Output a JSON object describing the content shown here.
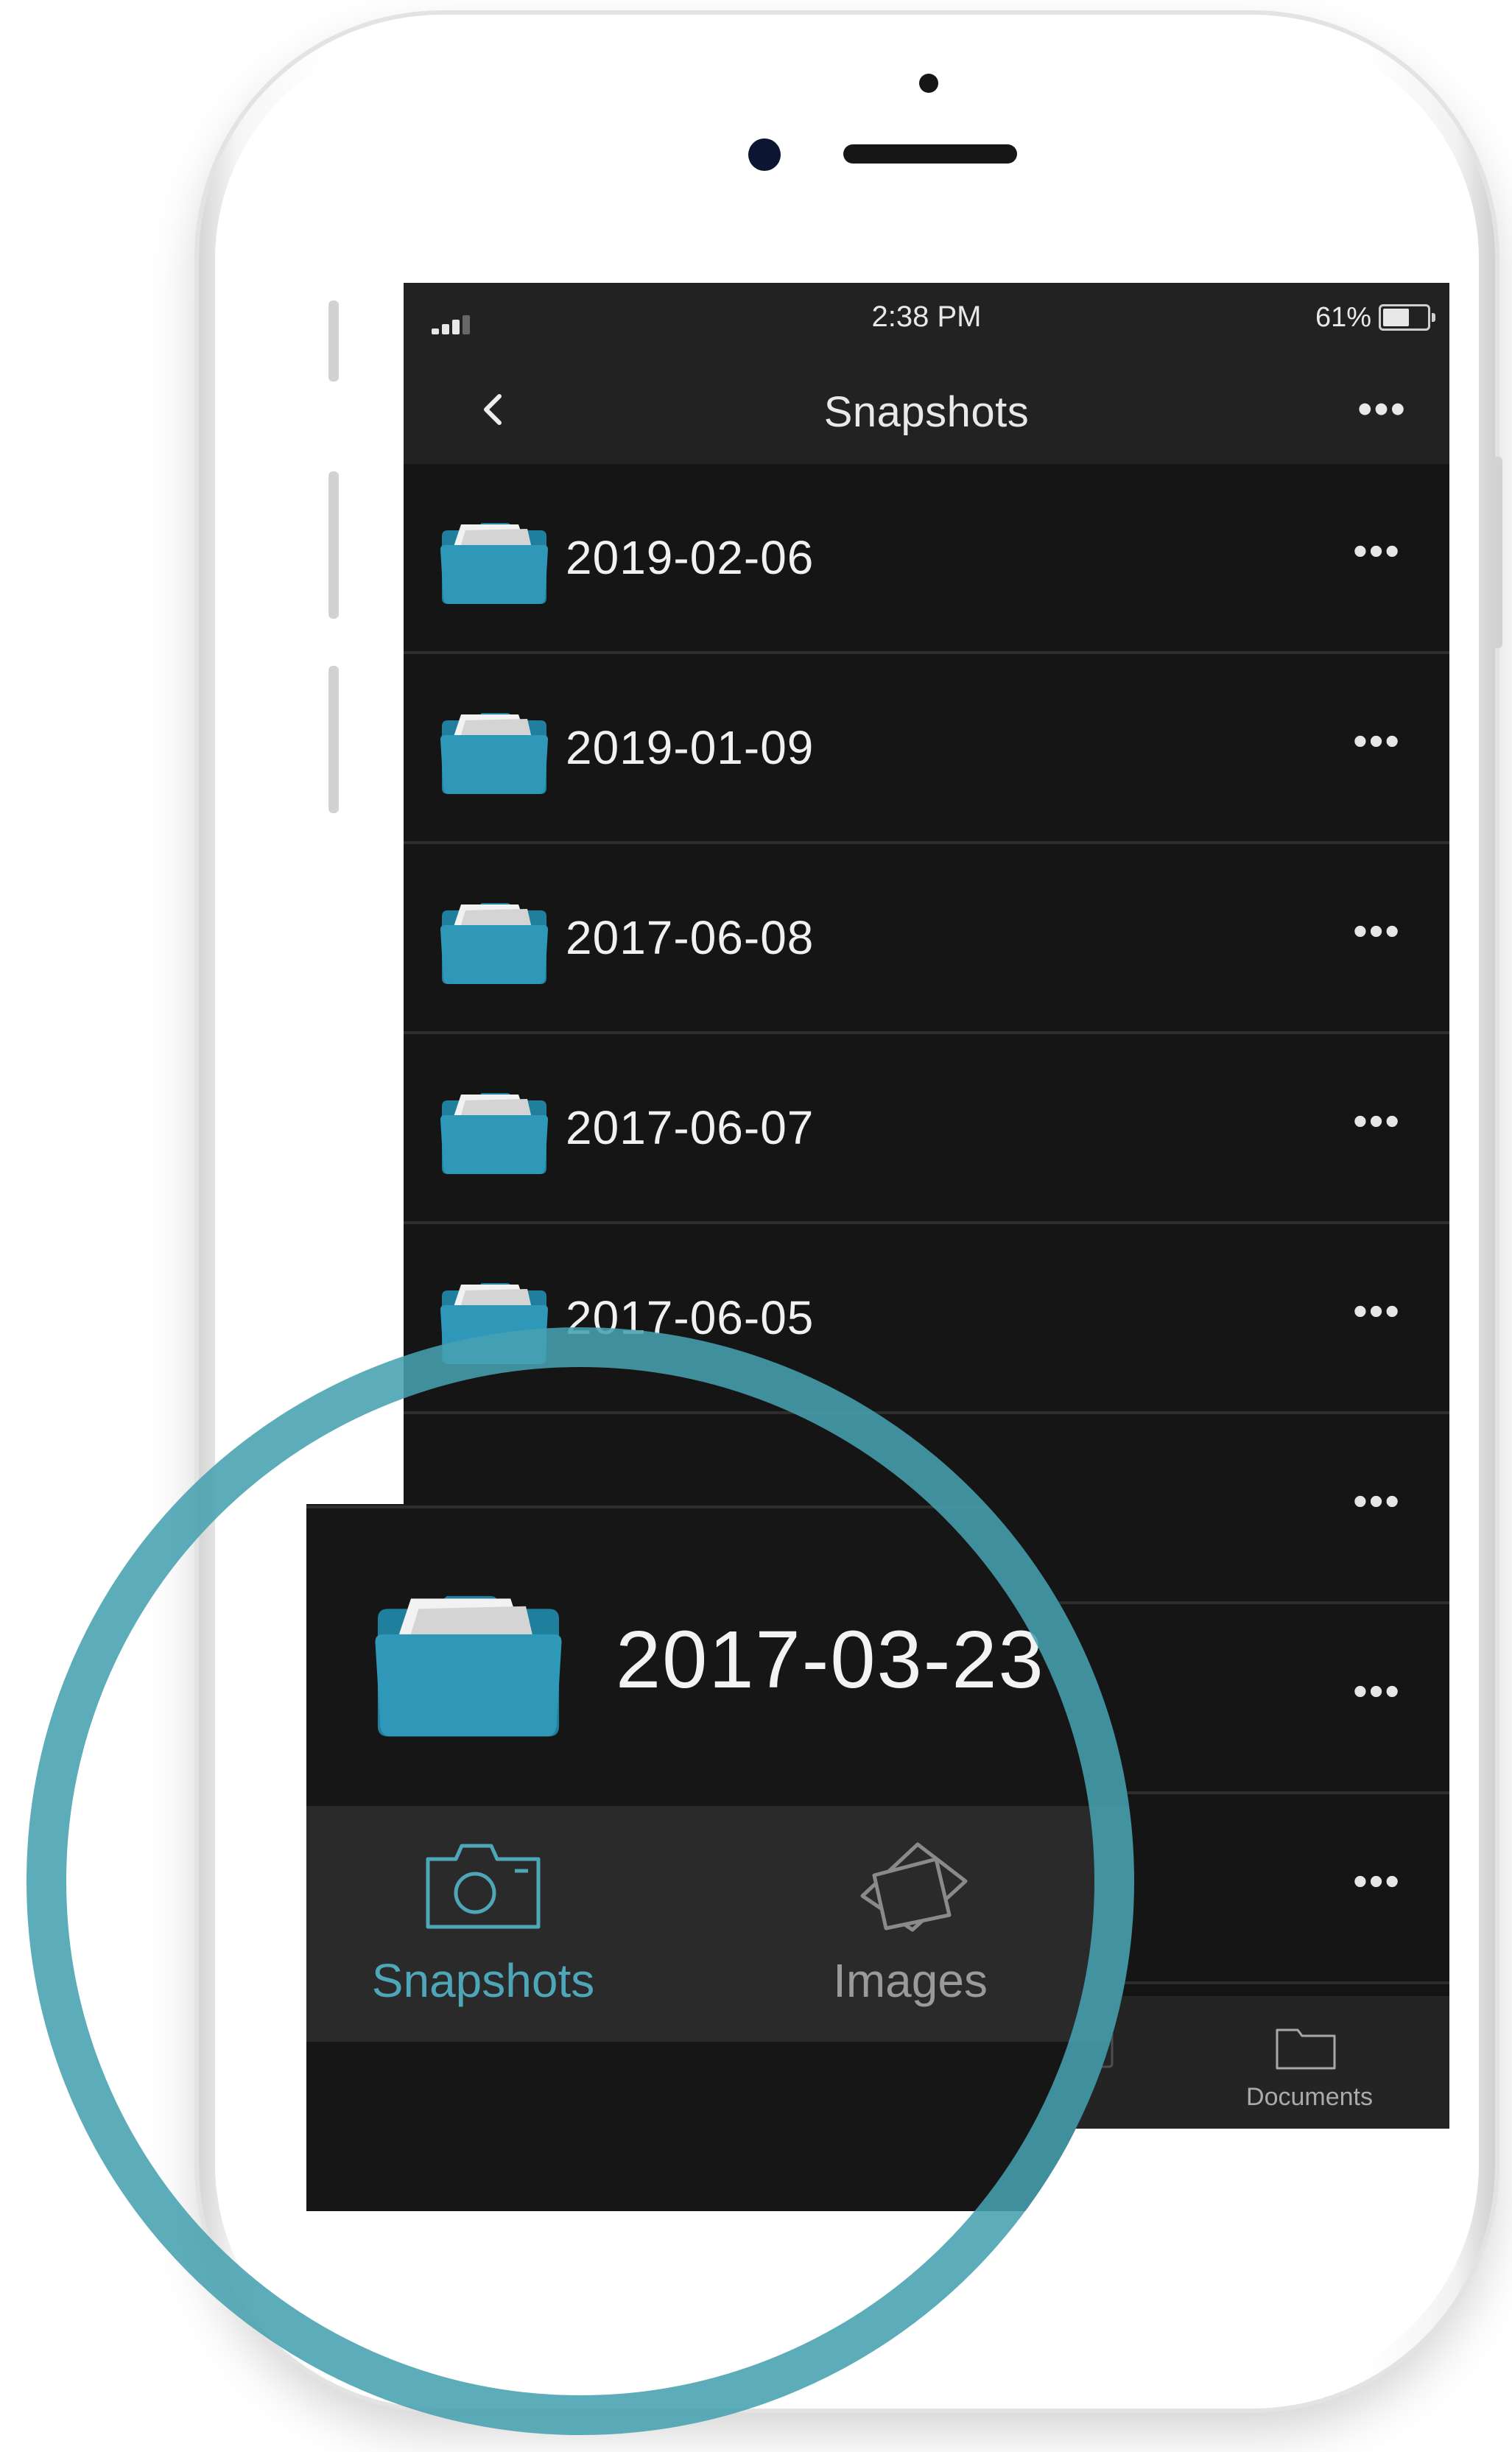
{
  "status_bar": {
    "time": "2:38 PM",
    "battery": "61%",
    "battery_level": 0.61
  },
  "nav": {
    "title": "Snapshots",
    "back_icon": "chevron-left-icon",
    "more_icon": "ellipsis-icon",
    "more_label": "•••"
  },
  "rows": [
    {
      "label": "2019-02-06",
      "more_label": "•••"
    },
    {
      "label": "2019-01-09",
      "more_label": "•••"
    },
    {
      "label": "2017-06-08",
      "more_label": "•••"
    },
    {
      "label": "2017-06-07",
      "more_label": "•••"
    },
    {
      "label": "2017-06-05",
      "more_label": "•••"
    },
    {
      "label": "",
      "more_label": "•••"
    },
    {
      "label": "",
      "more_label": "•••"
    },
    {
      "label": "",
      "more_label": "•••"
    }
  ],
  "bottom_tabs": {
    "documents_label": "Documents"
  },
  "magnifier": {
    "folder_label": "2017-03-23",
    "tabs": [
      {
        "label": "Snapshots",
        "icon": "camera-icon",
        "active": true
      },
      {
        "label": "Images",
        "icon": "images-icon",
        "active": false
      }
    ]
  },
  "colors": {
    "accent": "#5aaab8",
    "ring": "#46a0b0",
    "folder": "#2f96b4",
    "screen_bg": "#151515",
    "bar_bg": "#222222"
  }
}
